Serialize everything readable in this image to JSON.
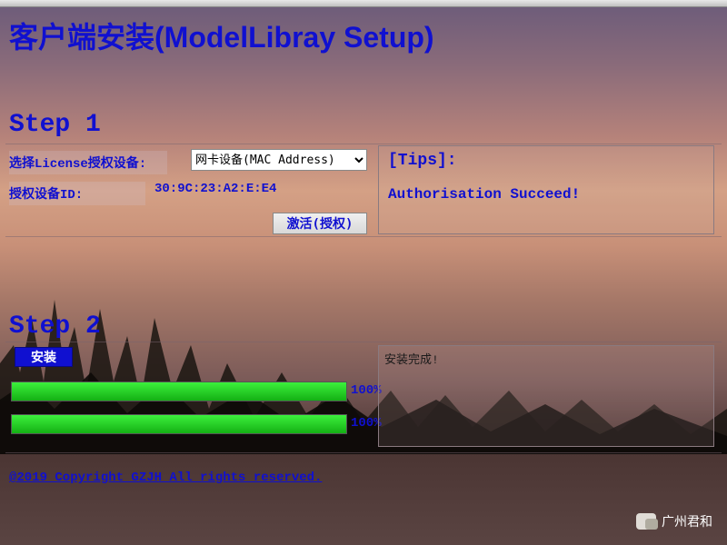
{
  "title": "客户端安装(ModelLibray Setup)",
  "step1": {
    "label": "Step 1",
    "license_device_label": "选择License授权设备:",
    "device_select_value": "网卡设备(MAC Address)",
    "device_id_label": "授权设备ID:",
    "device_id_value": "30:9C:23:A2:E:E4",
    "activate_button": "激活(授权)",
    "tips_header": "[Tips]:",
    "tips_body": "Authorisation Succeed!"
  },
  "step2": {
    "label": "Step 2",
    "install_button": "安装",
    "progress1": {
      "percent": 100,
      "text": "100%"
    },
    "progress2": {
      "percent": 100,
      "text": "100%"
    },
    "status_text": "安装完成!"
  },
  "copyright": "@2019 Copyright GZJH All rights reserved.",
  "watermark": "广州君和"
}
